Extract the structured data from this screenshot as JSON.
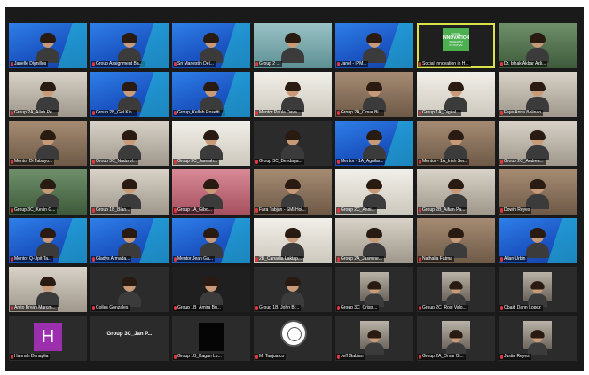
{
  "meeting": {
    "tiles": [
      {
        "name": "Janelle Dignillos",
        "style": "blue",
        "kind": "person"
      },
      {
        "name": "Group Assignment Ba...",
        "style": "blue",
        "kind": "person"
      },
      {
        "name": "Sri Marlestin Del...",
        "style": "blue",
        "kind": "person"
      },
      {
        "name": "Group 2 ...",
        "style": "teal",
        "kind": "person"
      },
      {
        "name": "Janel - IPM...",
        "style": "blue",
        "kind": "person"
      },
      {
        "name": "Social Innovation in H...",
        "style": "dark",
        "kind": "poster",
        "active": true
      },
      {
        "name": "Dr. Ishak Akbar Azli...",
        "style": "green",
        "kind": "person"
      },
      {
        "name": "Group 2A_Allah Pe...",
        "style": "room",
        "kind": "person"
      },
      {
        "name": "Group 2B_Gel Kin...",
        "style": "blue",
        "kind": "person"
      },
      {
        "name": "Group_Kellah Rosetti...",
        "style": "blue",
        "kind": "person"
      },
      {
        "name": "Mentor Paula Dava...",
        "style": "light",
        "kind": "person"
      },
      {
        "name": "Group 2A_Omar Bi...",
        "style": "warm",
        "kind": "person"
      },
      {
        "name": "Group 1A_Digital...",
        "style": "light",
        "kind": "person"
      },
      {
        "name": "Faye Anna Bolinao",
        "style": "room",
        "kind": "person"
      },
      {
        "name": "Mentor Di Tabayo...",
        "style": "warm",
        "kind": "person"
      },
      {
        "name": "Group 3C_Nadzrul...",
        "style": "room",
        "kind": "person"
      },
      {
        "name": "Group 3C_Jannah...",
        "style": "light",
        "kind": "person"
      },
      {
        "name": "Group 3C_Bendaga...",
        "style": "dim",
        "kind": "person"
      },
      {
        "name": "Mentor - 1A_Aguilar...",
        "style": "blue",
        "kind": "person"
      },
      {
        "name": "Mentor - 1A_Irish Ser...",
        "style": "warm",
        "kind": "person"
      },
      {
        "name": "Group 2C_Andrea...",
        "style": "room",
        "kind": "person"
      },
      {
        "name": "Group 3C_Kevin G...",
        "style": "green",
        "kind": "person"
      },
      {
        "name": "Group 1B_Blan...",
        "style": "room",
        "kind": "person"
      },
      {
        "name": "Group 1A_Gibo...",
        "style": "pink",
        "kind": "person"
      },
      {
        "name": "Fara Tabjan - SMI Hol...",
        "style": "warm",
        "kind": "person"
      },
      {
        "name": "Group 2C_Anni...",
        "style": "light",
        "kind": "person"
      },
      {
        "name": "Group 2B_Alfian Pa...",
        "style": "room",
        "kind": "person"
      },
      {
        "name": "Dowin Reyes",
        "style": "warm",
        "kind": "person"
      },
      {
        "name": "Mentor Q-Upit Ta...",
        "style": "blue",
        "kind": "person"
      },
      {
        "name": "Gladys Armada...",
        "style": "blue",
        "kind": "person"
      },
      {
        "name": "Mentor Jean Ga...",
        "style": "blue",
        "kind": "person"
      },
      {
        "name": "2B_Canadia Laktap...",
        "style": "light",
        "kind": "person"
      },
      {
        "name": "Group 2A_Jasmine...",
        "style": "room",
        "kind": "person"
      },
      {
        "name": "Nathalia Fatma",
        "style": "warm",
        "kind": "person"
      },
      {
        "name": "Allan Urbin",
        "style": "blue",
        "kind": "person"
      },
      {
        "name": "Anito Bryan Marcm...",
        "style": "room",
        "kind": "person"
      },
      {
        "name": "Colles Gonzales",
        "style": "dim",
        "kind": "person"
      },
      {
        "name": "Group 1B_Amira Bu...",
        "style": "dark",
        "kind": "person"
      },
      {
        "name": "Group 1B_John Br...",
        "style": "dim",
        "kind": "person"
      },
      {
        "name": "Group 3C_Crispi...",
        "style": "dim",
        "kind": "mini"
      },
      {
        "name": "Group 2C_Rosi Valo...",
        "style": "dim",
        "kind": "mini"
      },
      {
        "name": "Obaid Dann Lopez",
        "style": "dim",
        "kind": "mini"
      },
      {
        "name": "Hannah Dimaplia",
        "style": "dim",
        "kind": "letter",
        "letter": "H"
      },
      {
        "name": "Group 3C_Jan P...",
        "style": "dim",
        "kind": "center"
      },
      {
        "name": "Group 1B_Kagan Lu...",
        "style": "dim",
        "kind": "darkthumb"
      },
      {
        "name": "M. Tanjuatco",
        "style": "dim",
        "kind": "seal"
      },
      {
        "name": "Jeff Gabian",
        "style": "dim",
        "kind": "mini"
      },
      {
        "name": "Group 2A_Omar Bi...",
        "style": "dim",
        "kind": "mini"
      },
      {
        "name": "Justin Reyes",
        "style": "dim",
        "kind": "mini"
      }
    ],
    "poster": {
      "line1": "SOCIAL",
      "line2": "INNOVATION",
      "line3": "IN HEALTH",
      "line4": "INITIATIVE"
    }
  },
  "colors": {
    "active_border": "#d8e34a",
    "tile_blue": "#2f7fe8",
    "muted_mic": "#e0363d"
  }
}
